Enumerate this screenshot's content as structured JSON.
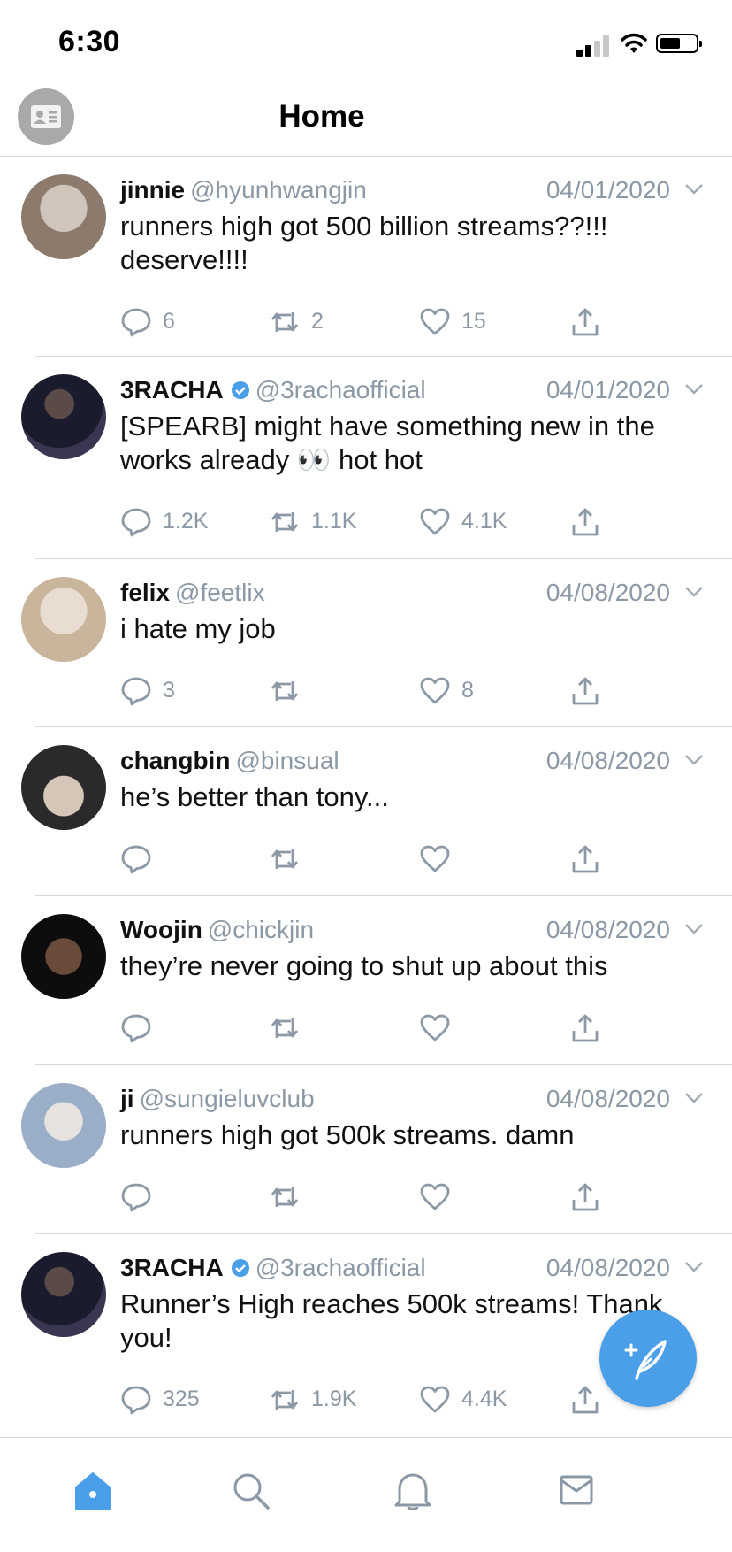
{
  "status_bar": {
    "time": "6:30"
  },
  "header": {
    "title": "Home",
    "profile_icon": "profile-card-icon"
  },
  "tweets": [
    {
      "name": "jinnie",
      "verified": false,
      "handle": "@hyunhwangjin",
      "date": "04/01/2020",
      "text": "runners high got 500 billion streams??!!! deserve!!!!",
      "replies": "6",
      "retweets": "2",
      "likes": "15",
      "avatar_colors": [
        "#8c7a6c",
        "#cfc5bb"
      ]
    },
    {
      "name": "3RACHA",
      "verified": true,
      "handle": "@3rachaofficial",
      "date": "04/01/2020",
      "text": "[SPEARB] might have something new in the works already 👀 hot hot",
      "replies": "1.2K",
      "retweets": "1.1K",
      "likes": "4.1K",
      "avatar_colors": [
        "#1a1c2e",
        "#3a3550"
      ]
    },
    {
      "name": "felix",
      "verified": false,
      "handle": "@feetlix",
      "date": "04/08/2020",
      "text": "i hate my job",
      "replies": "3",
      "retweets": "",
      "likes": "8",
      "avatar_colors": [
        "#c9b59c",
        "#e8ddd0"
      ]
    },
    {
      "name": "changbin",
      "verified": false,
      "handle": "@binsual",
      "date": "04/08/2020",
      "text": "he’s better than tony...",
      "replies": "",
      "retweets": "",
      "likes": "",
      "avatar_colors": [
        "#2a2a2a",
        "#d4c7b8"
      ]
    },
    {
      "name": "Woojin",
      "verified": false,
      "handle": "@chickjin",
      "date": "04/08/2020",
      "text": "they’re never going to shut up about this",
      "replies": "",
      "retweets": "",
      "likes": "",
      "avatar_colors": [
        "#0d0d0d",
        "#6a4a3a"
      ]
    },
    {
      "name": "ji",
      "verified": false,
      "handle": "@sungieluvclub",
      "date": "04/08/2020",
      "text": "runners high got 500k streams. damn",
      "replies": "",
      "retweets": "",
      "likes": "",
      "avatar_colors": [
        "#9aaec8",
        "#e6e2de"
      ]
    },
    {
      "name": "3RACHA",
      "verified": true,
      "handle": "@3rachaofficial",
      "date": "04/08/2020",
      "text": "Runner’s High reaches 500k streams! Thank you!",
      "replies": "325",
      "retweets": "1.9K",
      "likes": "4.4K",
      "avatar_colors": [
        "#1a1c2e",
        "#3a3550"
      ]
    }
  ],
  "compose_button": {
    "icon": "compose-feather-icon",
    "color": "#4a9fe8"
  },
  "tab_bar": {
    "tabs": [
      "home-icon",
      "search-icon",
      "notifications-bell-icon",
      "messages-envelope-icon"
    ],
    "active": "home-icon",
    "accent": "#4a9fe8"
  }
}
